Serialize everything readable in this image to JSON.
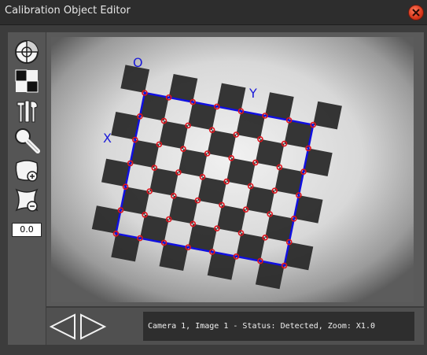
{
  "window": {
    "title": "Calibration Object Editor"
  },
  "toolbar": {
    "tools": [
      "target-tool-icon",
      "checker-pattern-icon",
      "tools-icon",
      "magnifier-icon",
      "zoom-in-icon",
      "zoom-out-icon"
    ],
    "zoom_value": "0.0"
  },
  "image": {
    "origin_label": "O",
    "x_label": "X",
    "y_label": "Y",
    "colors": {
      "grid_outline": "#1010e0",
      "corner_marker": "#e0141e",
      "axis_label": "#1a1ad8"
    }
  },
  "navigation": {
    "prev": "left-arrow-icon",
    "next": "right-arrow-icon"
  },
  "status": {
    "text": "Camera 1, Image 1 - Status: Detected, Zoom: X1.0"
  }
}
